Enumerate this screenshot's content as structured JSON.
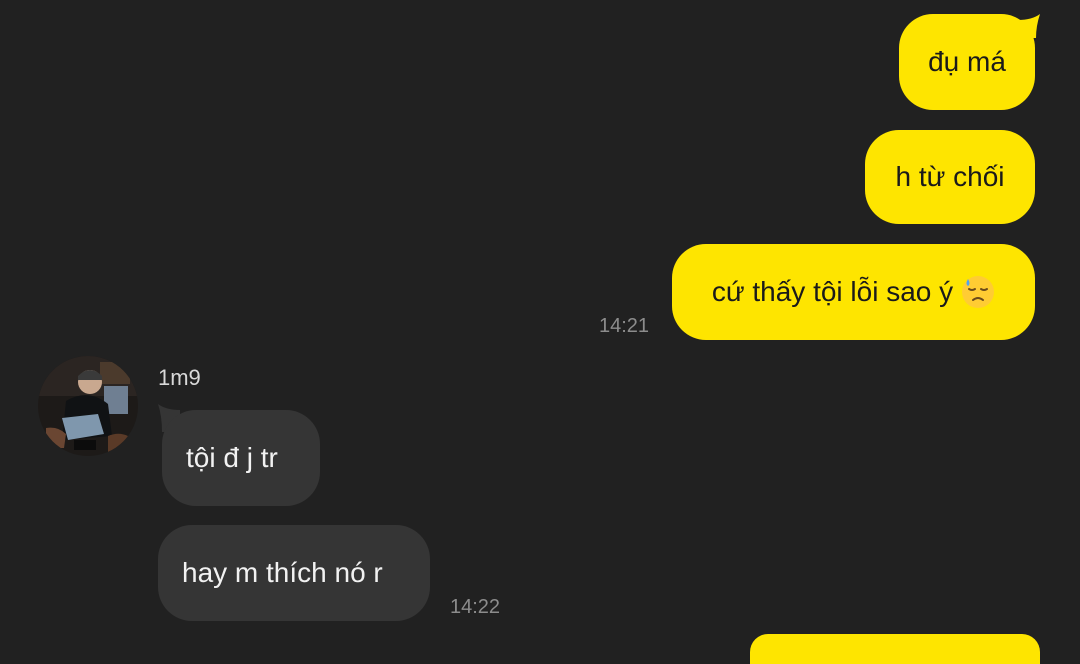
{
  "chat": {
    "messages_out": [
      {
        "text": "đụ má"
      },
      {
        "text": "h từ chối"
      },
      {
        "text": "cứ thấy tội lỗi sao ý",
        "emoji": "sad-sweat-face-emoji"
      }
    ],
    "time_out": "14:21",
    "sender": {
      "name": "1m9",
      "avatar": "contact-avatar-photo"
    },
    "messages_in": [
      {
        "text": "tội đ j tr"
      },
      {
        "text": "hay m thích nó r"
      }
    ],
    "time_in": "14:22"
  },
  "colors": {
    "background": "#212121",
    "outgoing_bubble": "#fee500",
    "incoming_bubble": "#353535",
    "outgoing_text": "#1a1a1a",
    "incoming_text": "#f2f2f2",
    "timestamp": "#8c8c8c"
  }
}
